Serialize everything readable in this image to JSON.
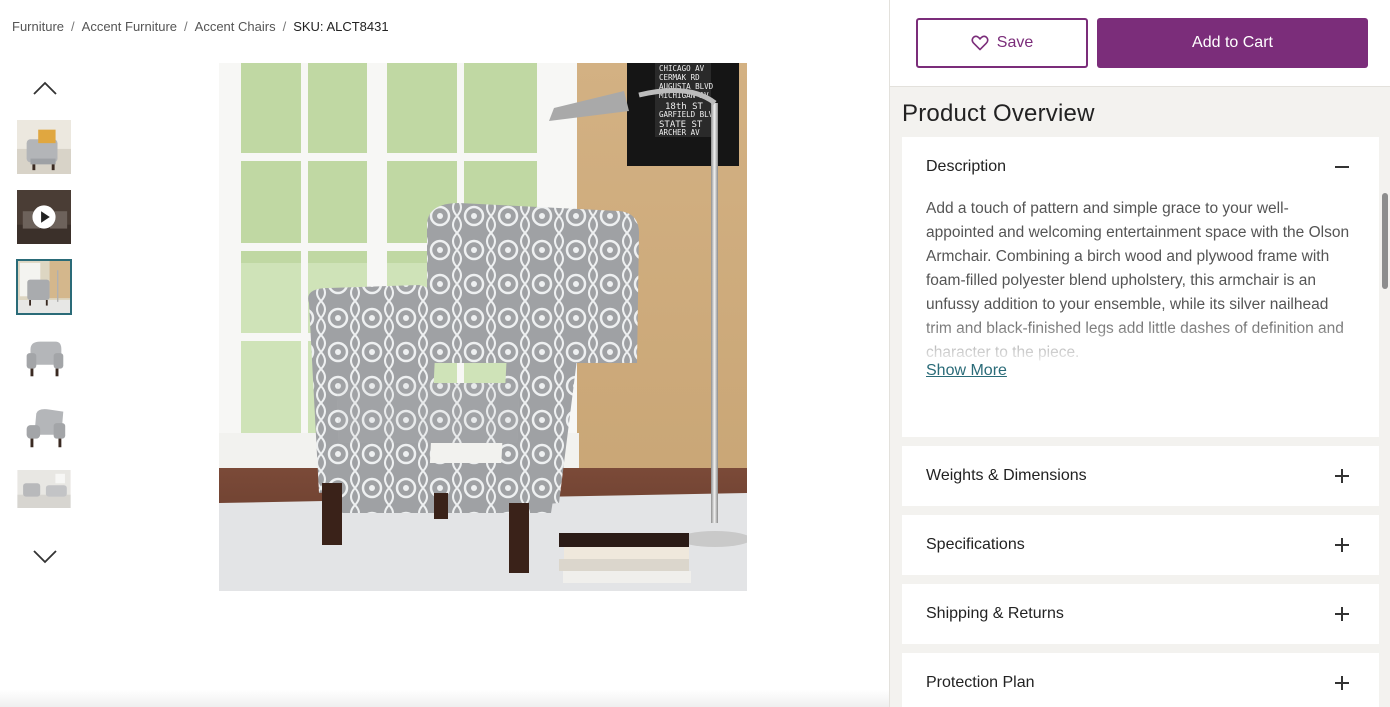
{
  "breadcrumb": {
    "items": [
      "Furniture",
      "Accent Furniture",
      "Accent Chairs"
    ],
    "separator": "/",
    "sku": "SKU: ALCT8431"
  },
  "gallery": {
    "thumbnails": [
      {
        "kind": "image",
        "icon": "chair-thumbnail"
      },
      {
        "kind": "video",
        "icon": "play-icon"
      },
      {
        "kind": "image",
        "icon": "chair-thumbnail",
        "active": true
      },
      {
        "kind": "image",
        "icon": "chair-thumbnail"
      },
      {
        "kind": "image",
        "icon": "chair-thumbnail"
      },
      {
        "kind": "image",
        "icon": "room-thumbnail"
      }
    ],
    "up_icon": "chevron-up-icon",
    "down_icon": "chevron-down-icon"
  },
  "actions": {
    "save_label": "Save",
    "save_icon": "heart-icon",
    "add_to_cart_label": "Add to Cart"
  },
  "overview": {
    "title": "Product Overview",
    "description": {
      "title": "Description",
      "expanded": true,
      "text": "Add a touch of pattern and simple grace to your well-appointed and welcoming entertainment space with the Olson Armchair. Combining a birch wood and plywood frame with foam-filled polyester blend upholstery, this armchair is an unfussy addition to your ensemble, while its silver nailhead trim and black-finished legs add little dashes of definition and character to the piece.",
      "show_more": "Show More"
    },
    "sections": [
      {
        "title": "Weights & Dimensions"
      },
      {
        "title": "Specifications"
      },
      {
        "title": "Shipping & Returns"
      },
      {
        "title": "Protection Plan"
      }
    ]
  },
  "poster": {
    "lines": [
      "CHICAGO AV",
      "CERMAK RD",
      "AUGUSTA BLVD",
      "MICHIGAN AV",
      "18th ST",
      "GARFIELD BLVD",
      "STATE ST",
      "ARCHER AV"
    ]
  },
  "colors": {
    "accent": "#7b2d7a",
    "link": "#2a6b78",
    "panel_bg": "#f3f2ef"
  }
}
